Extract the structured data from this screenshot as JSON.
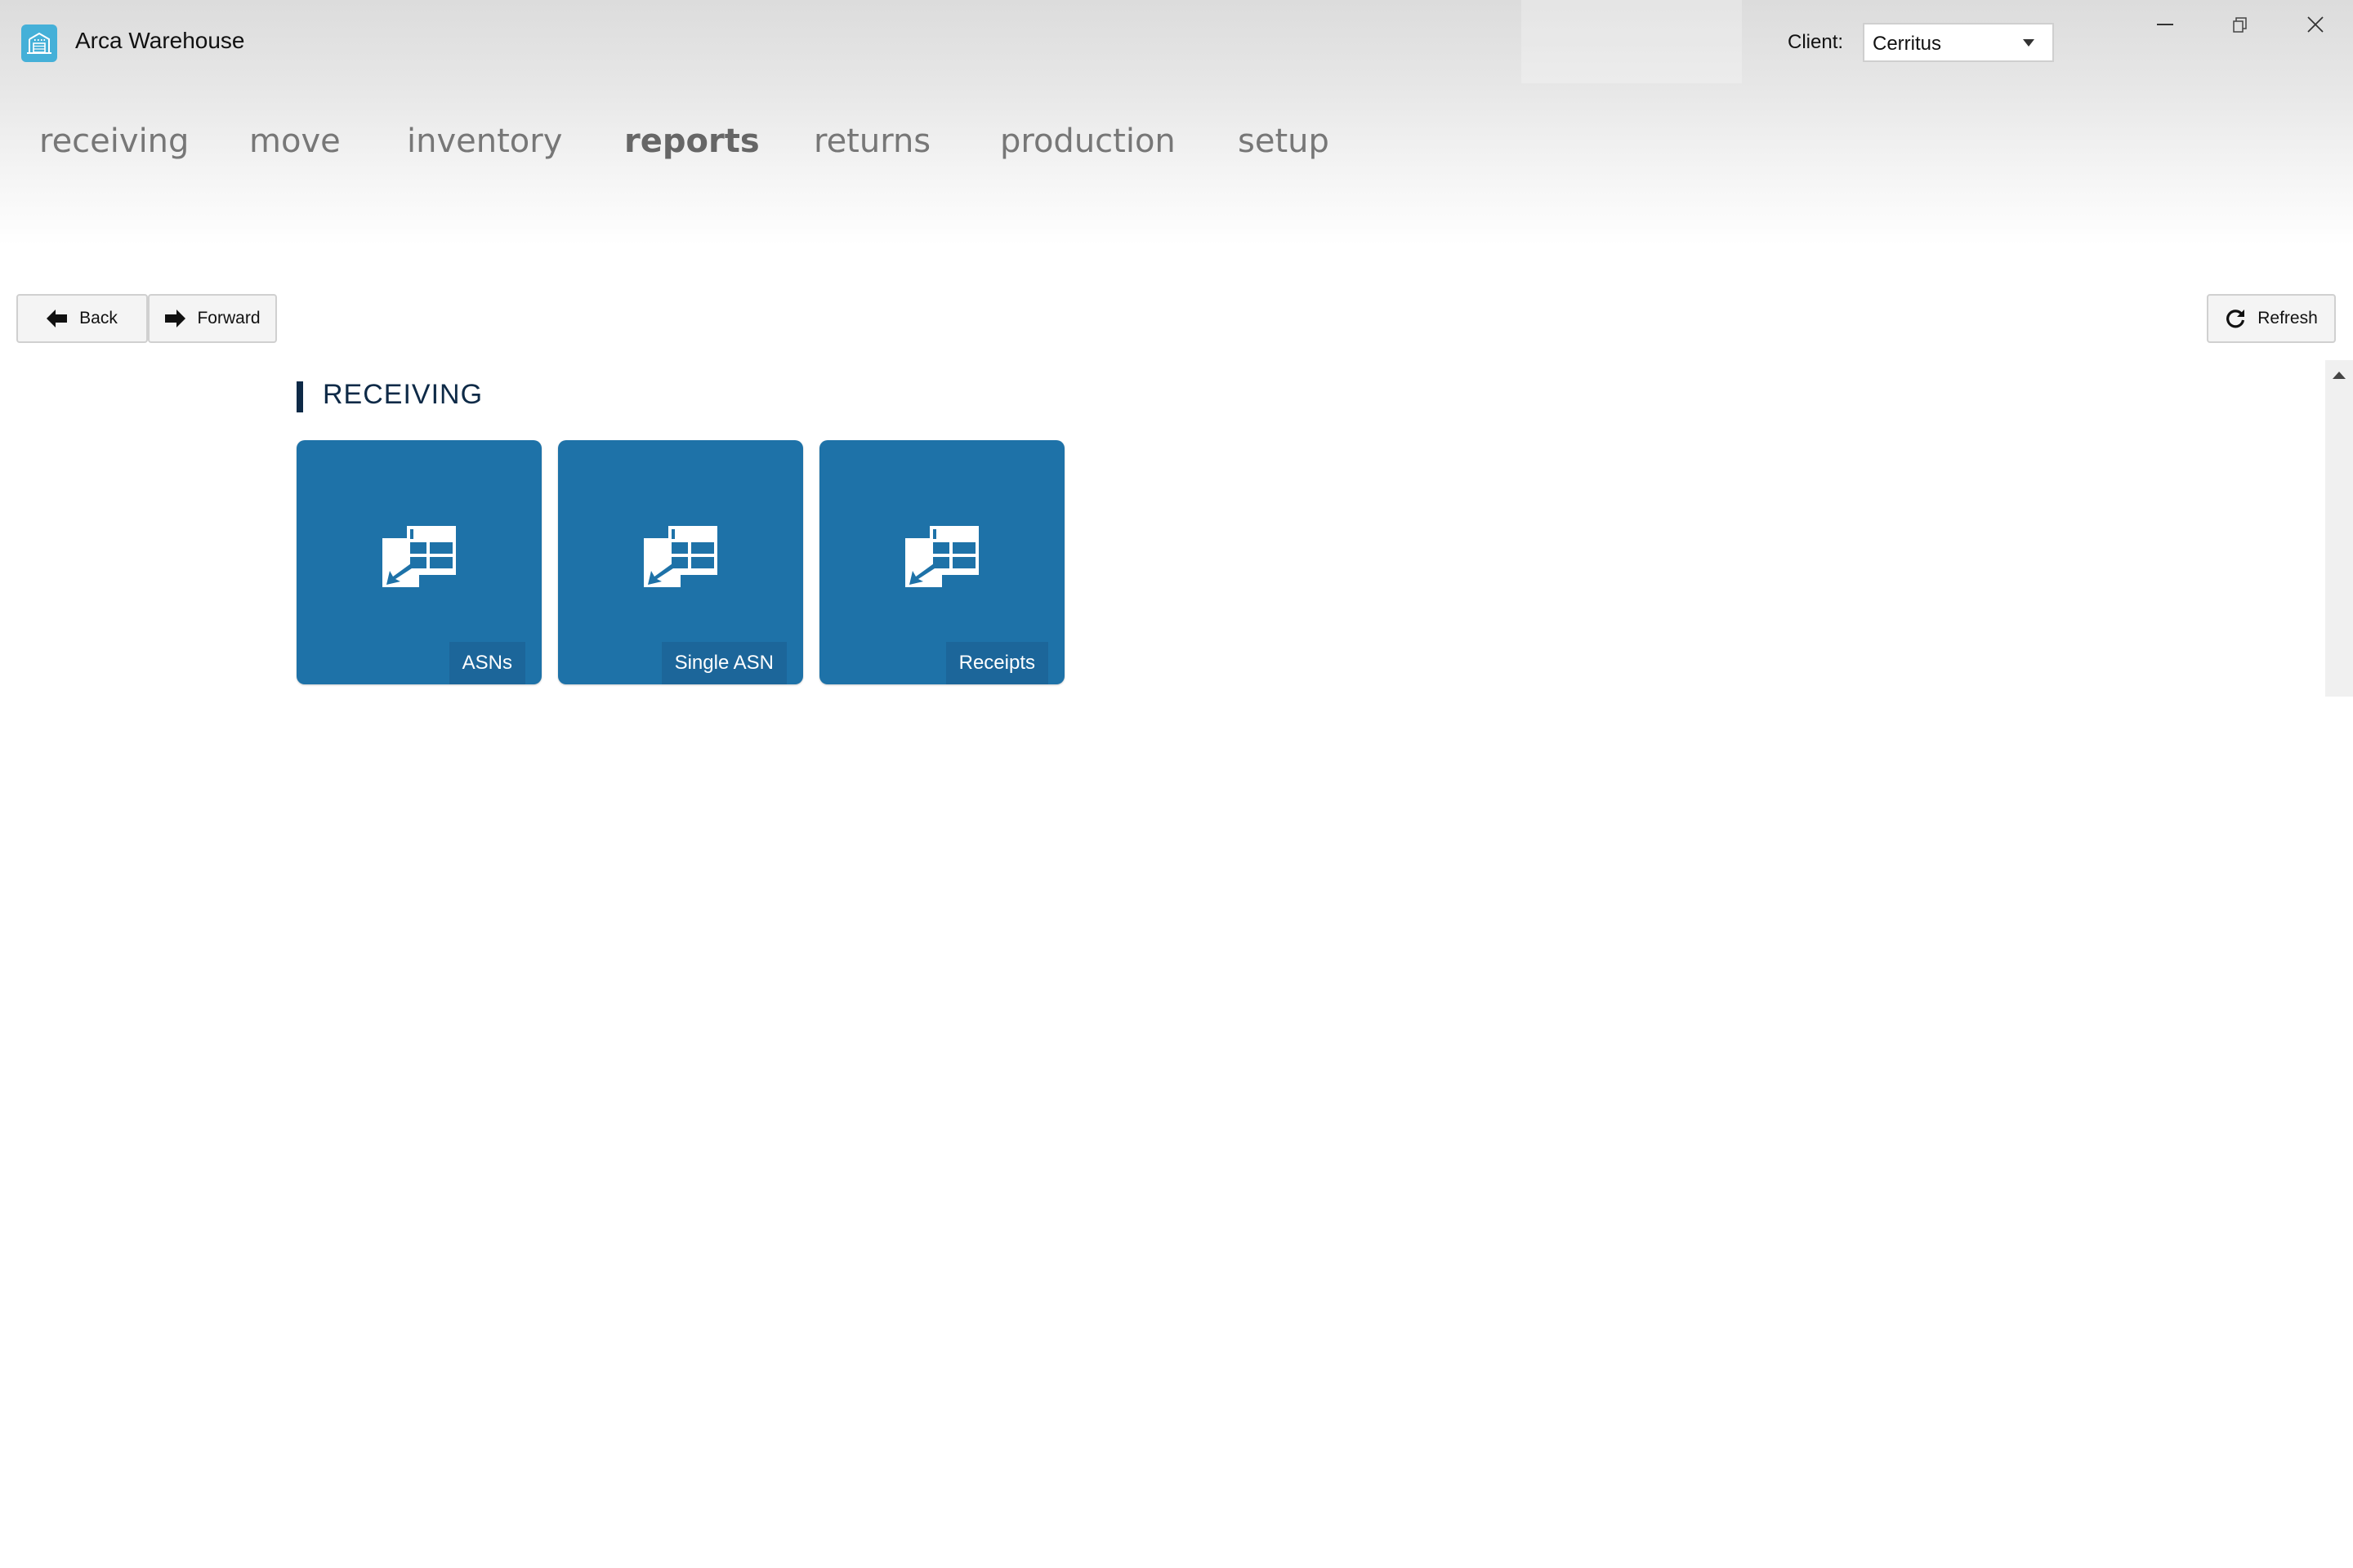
{
  "app": {
    "title": "Arca Warehouse",
    "logo_icon": "warehouse-icon",
    "brand_color": "#45b0d8"
  },
  "client": {
    "label": "Client:",
    "selected": "Cerritus"
  },
  "window_controls": {
    "minimize": "minimize-icon",
    "restore": "restore-icon",
    "close": "close-icon"
  },
  "nav": {
    "items": [
      {
        "label": "receiving",
        "active": false
      },
      {
        "label": "move",
        "active": false
      },
      {
        "label": "inventory",
        "active": false
      },
      {
        "label": "reports",
        "active": true
      },
      {
        "label": "returns",
        "active": false
      },
      {
        "label": "production",
        "active": false
      },
      {
        "label": "setup",
        "active": false
      }
    ]
  },
  "toolbar": {
    "back_label": "Back",
    "forward_label": "Forward",
    "refresh_label": "Refresh"
  },
  "section": {
    "title": "RECEIVING",
    "accent_color": "#0e2a47",
    "tile_color": "#1e72a8",
    "tiles": [
      {
        "label": "ASNs",
        "icon": "table-import-icon"
      },
      {
        "label": "Single ASN",
        "icon": "table-import-icon"
      },
      {
        "label": "Receipts",
        "icon": "table-import-icon"
      }
    ]
  }
}
